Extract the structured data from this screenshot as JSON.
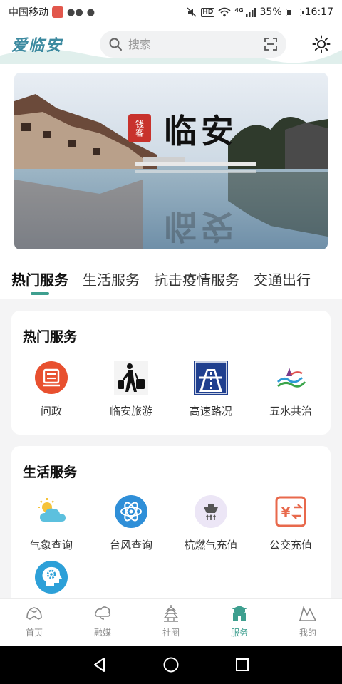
{
  "status_bar": {
    "carrier": "中国移动",
    "network": "4G",
    "battery": "35%",
    "battery_level": 0.35,
    "time": "16:17"
  },
  "header": {
    "logo_text": "爱临安",
    "search_placeholder": "搜索"
  },
  "banner": {
    "title": "临安",
    "seal_text": "钱客"
  },
  "tabs": [
    {
      "label": "热门服务",
      "active": true
    },
    {
      "label": "生活服务",
      "active": false
    },
    {
      "label": "抗击疫情服务",
      "active": false
    },
    {
      "label": "交通出行",
      "active": false
    }
  ],
  "hot_services": {
    "title": "热门服务",
    "items": [
      {
        "label": "问政",
        "icon": "wenzheng-icon"
      },
      {
        "label": "临安旅游",
        "icon": "traveler-icon"
      },
      {
        "label": "高速路况",
        "icon": "highway-icon"
      },
      {
        "label": "五水共治",
        "icon": "water-governance-icon"
      }
    ]
  },
  "life_services": {
    "title": "生活服务",
    "items": [
      {
        "label": "气象查询",
        "icon": "weather-icon"
      },
      {
        "label": "台风查询",
        "icon": "typhoon-icon"
      },
      {
        "label": "杭燃气充值",
        "icon": "gas-stove-icon"
      },
      {
        "label": "公交充值",
        "icon": "bus-card-icon"
      },
      {
        "label": "",
        "icon": "brain-gear-icon"
      }
    ]
  },
  "bottom_nav": [
    {
      "label": "首页",
      "icon": "home-shell-icon",
      "active": false
    },
    {
      "label": "融媒",
      "icon": "cloud-media-icon",
      "active": false
    },
    {
      "label": "社圈",
      "icon": "pagoda-icon",
      "active": false
    },
    {
      "label": "服务",
      "icon": "palace-icon",
      "active": true
    },
    {
      "label": "我的",
      "icon": "mountain-icon",
      "active": false
    }
  ],
  "colors": {
    "accent": "#3e9f8f",
    "logo": "#3d8aa0",
    "wenzheng": "#e8502f",
    "highway": "#1f3f8f",
    "weather": "#5cc0de",
    "typhoon": "#2f8fd8",
    "bus_card": "#e8694c",
    "brain": "#2da0d8"
  }
}
